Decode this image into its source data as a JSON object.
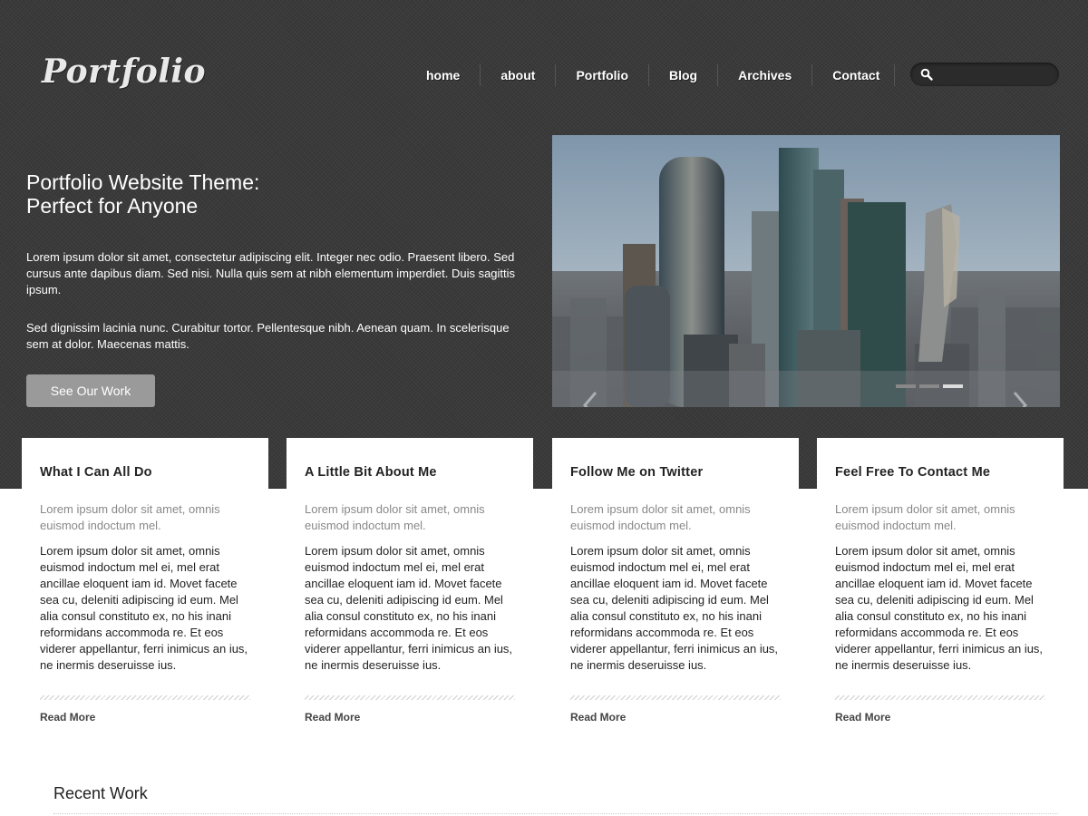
{
  "brand": {
    "logo_text": "Portfolio"
  },
  "nav": {
    "items": [
      "home",
      "about",
      "Portfolio",
      "Blog",
      "Archives",
      "Contact"
    ]
  },
  "search": {
    "placeholder": "",
    "icon": "search-icon"
  },
  "hero": {
    "title_line1": "Portfolio Website Theme:",
    "title_line2": "Perfect for Anyone",
    "paragraph1": "Lorem ipsum dolor sit amet, consectetur adipiscing elit. Integer nec odio. Praesent libero. Sed cursus ante dapibus diam. Sed nisi. Nulla quis sem at nibh elementum imperdiet. Duis sagittis ipsum.",
    "paragraph2": "Sed dignissim lacinia nunc. Curabitur tortor. Pellentesque nibh. Aenean quam. In scelerisque sem at dolor. Maecenas mattis.",
    "cta_label": "See Our Work"
  },
  "slider": {
    "image": "city skyline with skyscrapers",
    "prev_icon": "chevron-left-icon",
    "next_icon": "chevron-right-icon",
    "slide_count": 3,
    "active_slide": 3
  },
  "cards": [
    {
      "title": "What I Can All Do",
      "subtitle": "Lorem ipsum dolor sit amet, omnis euismod indoctum mel.",
      "body": "Lorem ipsum dolor sit amet, omnis euismod indoctum mel ei, mel erat ancillae eloquent iam id. Movet facete sea cu, deleniti adipiscing id eum. Mel alia consul constituto ex, no his inani reformidans accommoda re. Et eos viderer appellantur, ferri inimicus an ius, ne inermis deseruisse ius.",
      "link": "Read More"
    },
    {
      "title": "A Little Bit About Me",
      "subtitle": "Lorem ipsum dolor sit amet, omnis euismod indoctum mel.",
      "body": "Lorem ipsum dolor sit amet, omnis euismod indoctum mel ei, mel erat ancillae eloquent iam id. Movet facete sea cu, deleniti adipiscing id eum. Mel alia consul constituto ex, no his inani reformidans accommoda re. Et eos viderer appellantur, ferri inimicus an ius, ne inermis deseruisse ius.",
      "link": "Read More"
    },
    {
      "title": "Follow Me on Twitter",
      "subtitle": "Lorem ipsum dolor sit amet, omnis euismod indoctum mel.",
      "body": "Lorem ipsum dolor sit amet, omnis euismod indoctum mel ei, mel erat ancillae eloquent iam id. Movet facete sea cu, deleniti adipiscing id eum. Mel alia consul constituto ex, no his inani reformidans accommoda re. Et eos viderer appellantur, ferri inimicus an ius, ne inermis deseruisse ius.",
      "link": "Read More"
    },
    {
      "title": "Feel Free To Contact Me",
      "subtitle": "Lorem ipsum dolor sit amet, omnis euismod indoctum mel.",
      "body": "Lorem ipsum dolor sit amet, omnis euismod indoctum mel ei, mel erat ancillae eloquent iam id. Movet facete sea cu, deleniti adipiscing id eum. Mel alia consul constituto ex, no his inani reformidans accommoda re. Et eos viderer appellantur, ferri inimicus an ius, ne inermis deseruisse ius.",
      "link": "Read More"
    }
  ],
  "recent": {
    "heading": "Recent Work"
  },
  "colors": {
    "header_bg": "#3a3a3a",
    "cta_bg": "#9a9a9a",
    "card_bg": "#ffffff",
    "text_dark": "#222222",
    "text_muted": "#888888"
  }
}
